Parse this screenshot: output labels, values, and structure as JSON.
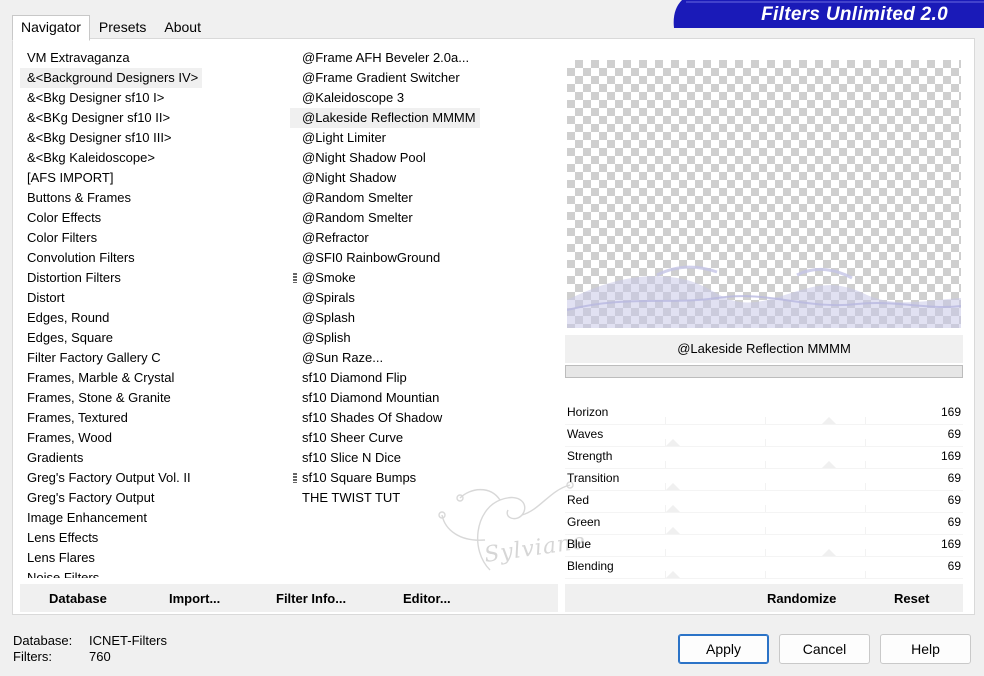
{
  "tabs": [
    "Navigator",
    "Presets",
    "About"
  ],
  "brand": "Filters Unlimited 2.0",
  "categories": [
    "VM Extravaganza",
    "&<Background Designers IV>",
    "&<Bkg Designer sf10 I>",
    "&<BKg Designer sf10 II>",
    "&<Bkg Designer sf10 III>",
    "&<Bkg Kaleidoscope>",
    "[AFS IMPORT]",
    "Buttons & Frames",
    "Color Effects",
    "Color Filters",
    "Convolution Filters",
    "Distortion Filters",
    "Distort",
    "Edges, Round",
    "Edges, Square",
    "Filter Factory Gallery C",
    "Frames, Marble & Crystal",
    "Frames, Stone & Granite",
    "Frames, Textured",
    "Frames, Wood",
    "Gradients",
    "Greg's Factory Output Vol. II",
    "Greg's Factory Output",
    "Image Enhancement",
    "Lens Effects",
    "Lens Flares",
    "Noise Filters"
  ],
  "filters": [
    "@Frame AFH Beveler 2.0a...",
    "@Frame Gradient Switcher",
    "@Kaleidoscope 3",
    "@Lakeside Reflection MMMM",
    "@Light Limiter",
    "@Night Shadow Pool",
    "@Night Shadow",
    "@Random Smelter",
    "@Random Smelter",
    "@Refractor",
    "@SFI0 RainbowGround",
    "@Smoke",
    "@Spirals",
    "@Splash",
    "@Splish",
    "@Sun Raze...",
    "sf10 Diamond Flip",
    "sf10 Diamond Mountian",
    "sf10 Shades Of Shadow",
    "sf10 Sheer Curve",
    "sf10 Slice N Dice",
    "sf10 Square Bumps",
    "THE TWIST TUT"
  ],
  "watermark": "Sylviane",
  "selected_filter_name": "@Lakeside Reflection MMMM",
  "params": [
    {
      "label": "Horizon",
      "value": "169",
      "level": 169
    },
    {
      "label": "Waves",
      "value": "69",
      "level": 69
    },
    {
      "label": "Strength",
      "value": "169",
      "level": 169
    },
    {
      "label": "Transition",
      "value": "69",
      "level": 69
    },
    {
      "label": "Red",
      "value": "69",
      "level": 69
    },
    {
      "label": "Green",
      "value": "69",
      "level": 69
    },
    {
      "label": "Blue",
      "value": "169",
      "level": 169
    },
    {
      "label": "Blending",
      "value": "69",
      "level": 69
    }
  ],
  "buttons": {
    "database": "Database",
    "import": "Import...",
    "filter_info": "Filter Info...",
    "editor": "Editor...",
    "randomize": "Randomize",
    "reset": "Reset",
    "apply": "Apply",
    "cancel": "Cancel",
    "help": "Help"
  },
  "footer": {
    "database_label": "Database:",
    "database_value": "ICNET-Filters",
    "filters_label": "Filters:",
    "filters_value": "760"
  },
  "colors": {
    "brand_blue": "#1a1ab8",
    "preview_wave": "#c9c9e8",
    "accent": "#2b73c7"
  },
  "icons": {
    "grip": "drag-grip-icon"
  }
}
